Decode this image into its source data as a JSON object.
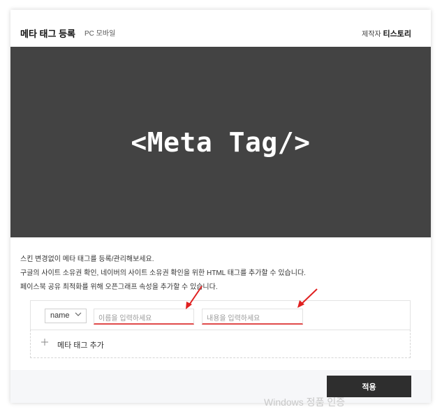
{
  "header": {
    "title": "메타 태그 등록",
    "subtitle": "PC 모바일",
    "maker_prefix": "제작자",
    "maker_name": "티스토리"
  },
  "banner": {
    "text": "<Meta Tag/>"
  },
  "description": [
    "스킨 변경없이 메타 태그를 등록/관리해보세요.",
    "구글의 사이트 소유권 확인, 네이버의 사이트 소유권 확인을 위한 HTML 태그를 추가할 수 있습니다.",
    "페이스북 공유 최적화를 위해 오픈그래프 속성을 추가할 수 있습니다."
  ],
  "meta_row": {
    "attribute_select": "name",
    "name_input_placeholder": "이름을 입력하세요",
    "content_input_placeholder": "내용을 입력하세요"
  },
  "add_row": {
    "label": "메타 태그 추가"
  },
  "footer": {
    "apply_label": "적용"
  },
  "watermark": "Windows 정품 인증",
  "icons": [
    "chevron-down-icon",
    "plus-icon",
    "arrow-annotation-icon"
  ],
  "colors": {
    "banner_bg": "#434343",
    "apply_bg": "#2e2e2e",
    "underline": "#e04a4a",
    "arrow": "#e02020"
  }
}
